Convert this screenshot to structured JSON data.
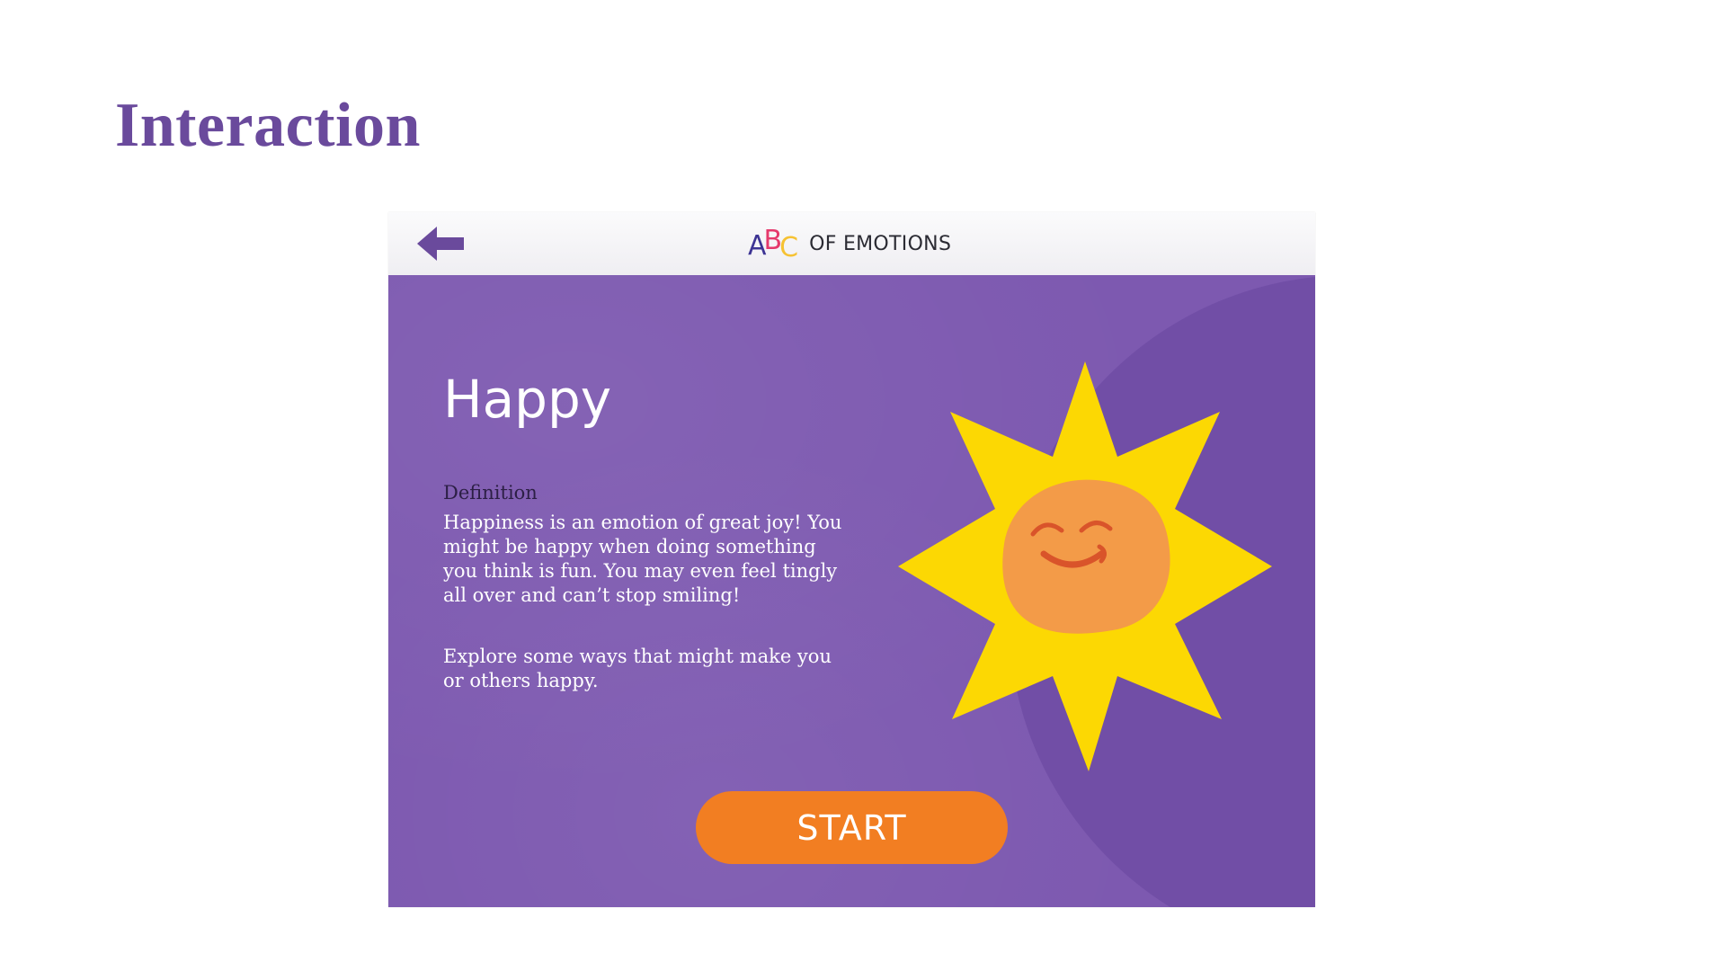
{
  "slide": {
    "title": "Interaction"
  },
  "app": {
    "header": {
      "back_icon": "arrow-left-icon",
      "logo_letters": [
        "A",
        "B",
        "C"
      ],
      "logo_text": "OF EMOTIONS"
    },
    "emotion": {
      "name": "Happy",
      "definition_label": "Definition",
      "definition_text": "Happiness is an emotion of great joy! You might be happy when doing something you think is fun. You may even feel tingly all over and can’t stop smiling!",
      "explore_text": "Explore some ways that might make you or others happy."
    },
    "start_label": "START",
    "illustration": "smiling-sun"
  },
  "colors": {
    "title": "#6a4a9c",
    "screen_background": "#7d59b0",
    "start_button": "#f27e22",
    "sun": "#fcd803",
    "sun_face": "#f39b48",
    "logo_a": "#3d3494",
    "logo_b": "#e5396c",
    "logo_c": "#f6c233"
  }
}
